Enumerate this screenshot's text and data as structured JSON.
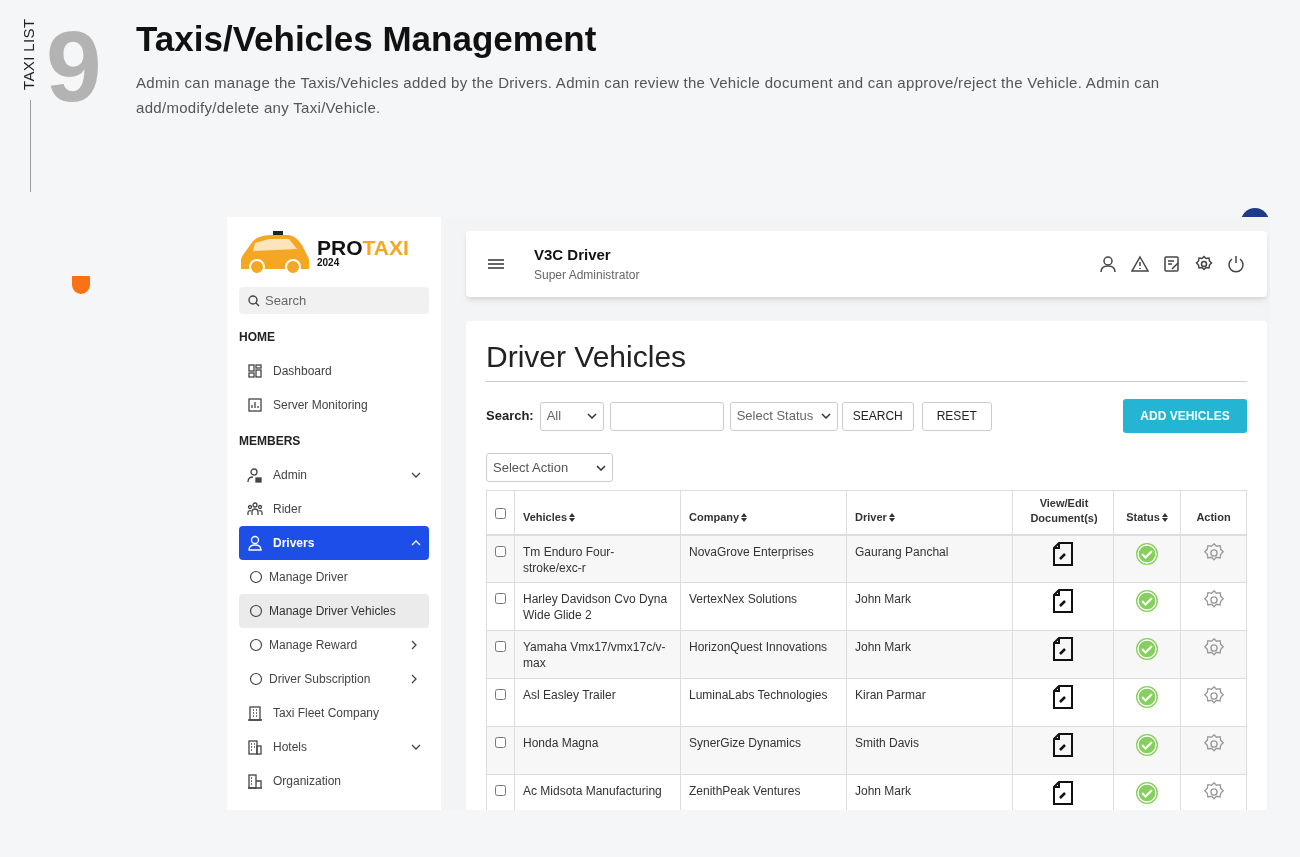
{
  "section_label": "TAXI LIST",
  "section_number": "9",
  "title": "Taxis/Vehicles Management",
  "description": "Admin can manage the Taxis/Vehicles added by the Drivers. Admin can review the Vehicle document and can approve/reject the Vehicle. Admin can add/modify/delete any Taxi/Vehicle.",
  "app": {
    "logo": {
      "brand_dark": "PRO",
      "brand_accent": "TAXI",
      "year": "2024"
    },
    "sidebar": {
      "search_placeholder": "Search",
      "items": [
        {
          "kind": "section",
          "label": "HOME"
        },
        {
          "kind": "item",
          "label": "Dashboard",
          "selected": false
        },
        {
          "kind": "item",
          "label": "Server Monitoring",
          "selected": false
        },
        {
          "kind": "section",
          "label": "MEMBERS"
        },
        {
          "kind": "item",
          "label": "Admin",
          "selected": false,
          "expanded": false
        },
        {
          "kind": "item",
          "label": "Rider",
          "selected": false
        },
        {
          "kind": "item",
          "label": "Drivers",
          "selected": true,
          "expanded": true
        },
        {
          "kind": "subitem",
          "label": "Manage Driver",
          "selected": false
        },
        {
          "kind": "subitem",
          "label": "Manage Driver Vehicles",
          "selected": true
        },
        {
          "kind": "subitem",
          "label": "Manage Reward",
          "selected": false,
          "expanded": false
        },
        {
          "kind": "subitem",
          "label": "Driver Subscription",
          "selected": false,
          "expanded": false
        },
        {
          "kind": "item",
          "label": "Taxi Fleet Company",
          "selected": false
        },
        {
          "kind": "item",
          "label": "Hotels",
          "selected": false,
          "expanded": false
        },
        {
          "kind": "item",
          "label": "Organization",
          "selected": false
        }
      ]
    },
    "topbar": {
      "user_name": "V3C Driver",
      "user_role": "Super Administrator"
    },
    "page_title": "Driver Vehicles",
    "filters": {
      "search_label": "Search:",
      "type_select": "All",
      "status_select": "Select Status",
      "search_button": "SEARCH",
      "reset_button": "RESET",
      "add_button": "ADD VEHICLES",
      "action_select": "Select Action"
    },
    "table": {
      "columns": [
        "Vehicles",
        "Company",
        "Driver",
        "View/Edit Document(s)",
        "Status",
        "Action"
      ],
      "header_checked": false,
      "rows": [
        {
          "checked": false,
          "vehicle": "Tm Enduro Four-stroke/exc-r",
          "company": "NovaGrove Enterprises",
          "driver": "Gaurang Panchal",
          "approved": true
        },
        {
          "checked": false,
          "vehicle": "Harley Davidson Cvo Dyna Wide Glide 2",
          "company": "VertexNex Solutions",
          "driver": "John Mark",
          "approved": true
        },
        {
          "checked": false,
          "vehicle": "Yamaha Vmx17/vmx17c/v-max",
          "company": "HorizonQuest Innovations",
          "driver": "John Mark",
          "approved": true
        },
        {
          "checked": false,
          "vehicle": "Asl Easley Trailer",
          "company": "LuminaLabs Technologies",
          "driver": "Kiran Parmar",
          "approved": true
        },
        {
          "checked": false,
          "vehicle": "Honda Magna",
          "company": "SynerGize Dynamics",
          "driver": "Smith Davis",
          "approved": true
        },
        {
          "checked": false,
          "vehicle": "Ac Midsota Manufacturing",
          "company": "ZenithPeak Ventures",
          "driver": "John Mark",
          "approved": true
        }
      ]
    }
  }
}
